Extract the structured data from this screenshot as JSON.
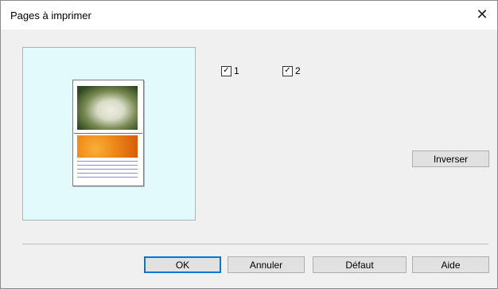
{
  "window": {
    "title": "Pages à imprimer",
    "close_icon": "close-icon"
  },
  "pages": [
    {
      "label": "1",
      "checked": true
    },
    {
      "label": "2",
      "checked": true
    }
  ],
  "buttons": {
    "reverse": "Inverser",
    "ok": "OK",
    "cancel": "Annuler",
    "default": "Défaut",
    "help": "Aide"
  },
  "colors": {
    "preview_bg": "#e3fafd",
    "accent": "#0078d7"
  }
}
